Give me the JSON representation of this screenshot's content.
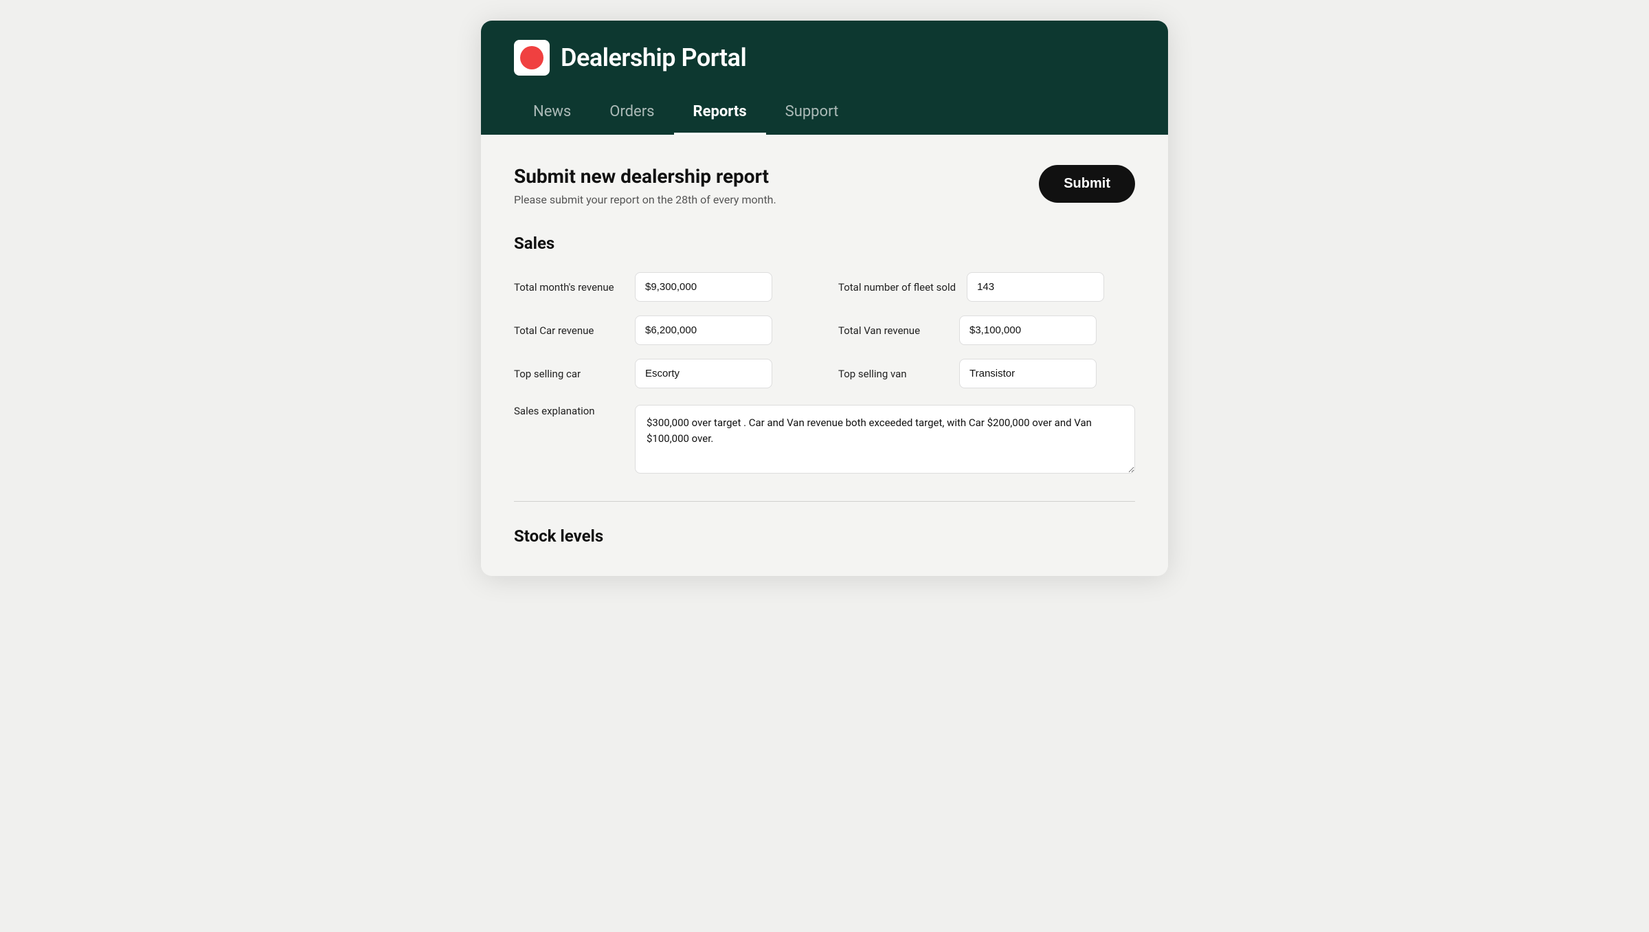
{
  "header": {
    "logo_alt": "Dealership Portal Logo",
    "title": "Dealership Portal",
    "nav": [
      {
        "label": "News",
        "active": false
      },
      {
        "label": "Orders",
        "active": false
      },
      {
        "label": "Reports",
        "active": true
      },
      {
        "label": "Support",
        "active": false
      }
    ]
  },
  "report": {
    "title": "Submit new dealership report",
    "subtitle": "Please submit your report on the 28th of every month.",
    "submit_label": "Submit"
  },
  "sales": {
    "section_title": "Sales",
    "fields": {
      "total_revenue_label": "Total month's revenue",
      "total_revenue_value": "$9,300,000",
      "fleet_sold_label": "Total number of fleet sold",
      "fleet_sold_value": "143",
      "car_revenue_label": "Total Car revenue",
      "car_revenue_value": "$6,200,000",
      "van_revenue_label": "Total Van revenue",
      "van_revenue_value": "$3,100,000",
      "top_car_label": "Top selling car",
      "top_car_value": "Escorty",
      "top_van_label": "Top selling van",
      "top_van_value": "Transistor",
      "explanation_label": "Sales explanation",
      "explanation_value": "$300,000 over target . Car and Van revenue both exceeded target, with Car $200,000 over and Van $100,000 over."
    }
  },
  "stock": {
    "section_title": "Stock levels"
  }
}
